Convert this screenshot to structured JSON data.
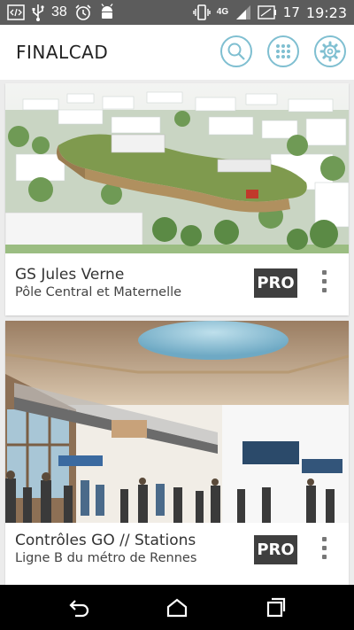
{
  "statusbar": {
    "notification_count": "38",
    "network": "4G",
    "battery": "17",
    "time": "19:23"
  },
  "app": {
    "title": "FINALCAD"
  },
  "projects": [
    {
      "title": "GS Jules Verne",
      "subtitle": "Pôle Central et Maternelle",
      "badge": "PRO"
    },
    {
      "title": "Contrôles GO // Stations",
      "subtitle": "Ligne B du métro de Rennes",
      "badge": "PRO"
    }
  ],
  "colors": {
    "accent": "#7fbfd1",
    "status_bar": "#5c5c5c",
    "badge_bg": "#3f3f3f"
  },
  "icons": [
    "code-icon",
    "usb-icon",
    "alarm-icon",
    "android-icon",
    "vibrate-icon",
    "signal-icon",
    "battery-icon",
    "search-icon",
    "apps-grid-icon",
    "settings-gear-icon",
    "more-vert-icon",
    "back-icon",
    "home-icon",
    "recents-icon"
  ]
}
